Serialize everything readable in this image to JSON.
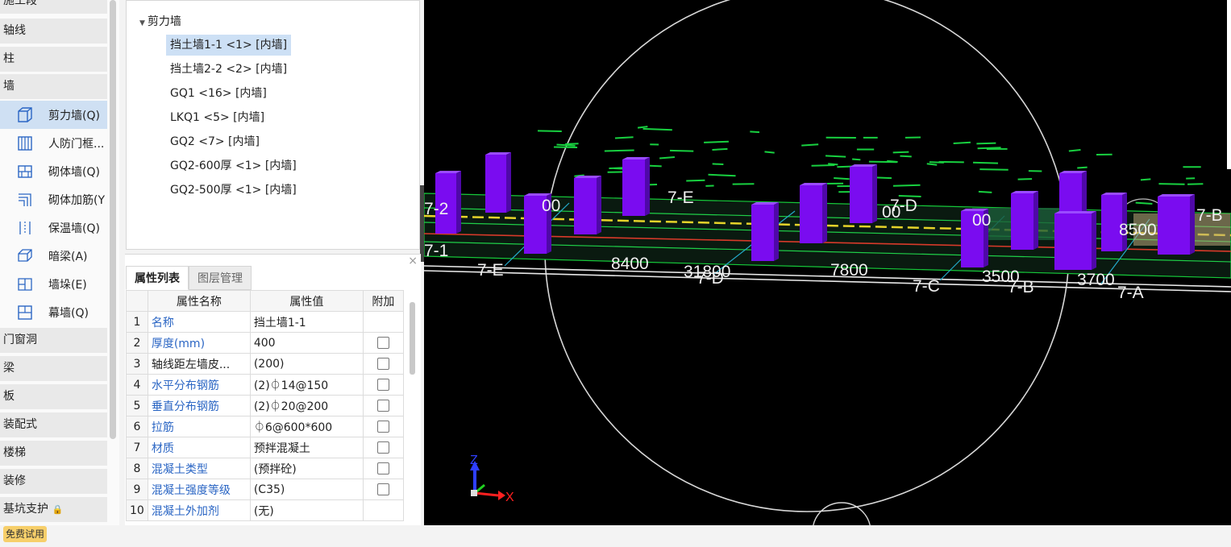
{
  "nav": {
    "top_partial": "施工段",
    "categories_top": [
      "轴线",
      "柱",
      "墙"
    ],
    "wall_items": [
      {
        "label": "剪力墙(Q)",
        "icon": "shear-wall-icon",
        "active": true
      },
      {
        "label": "人防门框...",
        "icon": "civil-defense-door-frame-icon"
      },
      {
        "label": "砌体墙(Q)",
        "icon": "masonry-wall-icon"
      },
      {
        "label": "砌体加筋(Y",
        "icon": "masonry-rebar-icon"
      },
      {
        "label": "保温墙(Q)",
        "icon": "insulation-wall-icon"
      },
      {
        "label": "暗梁(A)",
        "icon": "hidden-beam-icon"
      },
      {
        "label": "墙垛(E)",
        "icon": "wall-buttress-icon"
      },
      {
        "label": "幕墙(Q)",
        "icon": "curtain-wall-icon"
      }
    ],
    "categories_bottom": [
      "门窗洞",
      "梁",
      "板",
      "装配式",
      "楼梯",
      "装修"
    ],
    "last": {
      "label": "基坑支护",
      "badge": "免费试用"
    }
  },
  "tree": {
    "root": "剪力墙",
    "items": [
      "挡土墙1-1 <1> [内墙]",
      "挡土墙2-2 <2> [内墙]",
      "GQ1 <16> [内墙]",
      "LKQ1 <5> [内墙]",
      "GQ2 <7> [内墙]",
      "GQ2-600厚 <1> [内墙]",
      "GQ2-500厚 <1> [内墙]"
    ],
    "selected_index": 0
  },
  "props": {
    "close": "×",
    "tabs": [
      "属性列表",
      "图层管理"
    ],
    "headers": [
      "属性名称",
      "属性值",
      "附加"
    ],
    "rows": [
      {
        "no": "1",
        "name": "名称",
        "value": "挡土墙1-1",
        "blue": true,
        "check": false
      },
      {
        "no": "2",
        "name": "厚度(mm)",
        "value": "400",
        "blue": true,
        "check": true
      },
      {
        "no": "3",
        "name": "轴线距左墙皮...",
        "value": "(200)",
        "blue": false,
        "check": true
      },
      {
        "no": "4",
        "name": "水平分布钢筋",
        "value": "(2)⏀14@150",
        "blue": true,
        "check": true
      },
      {
        "no": "5",
        "name": "垂直分布钢筋",
        "value": "(2)⏀20@200",
        "blue": true,
        "check": true
      },
      {
        "no": "6",
        "name": "拉筋",
        "value": "⏀6@600*600",
        "blue": true,
        "check": true
      },
      {
        "no": "7",
        "name": "材质",
        "value": "预拌混凝土",
        "blue": true,
        "check": true
      },
      {
        "no": "8",
        "name": "混凝土类型",
        "value": "(预拌砼)",
        "blue": true,
        "check": true
      },
      {
        "no": "9",
        "name": "混凝土强度等级",
        "value": "(C35)",
        "blue": true,
        "check": true
      },
      {
        "no": "10",
        "name": "混凝土外加剂",
        "value": "(无)",
        "blue": true,
        "check": false
      }
    ]
  },
  "viewport": {
    "axis_labels": [
      "7-E",
      "7-D",
      "7-C",
      "7-B",
      "7-A",
      "7-2",
      "7-1",
      "7-E",
      "7-D",
      "7-B"
    ],
    "dimensions": [
      "8400",
      "31800",
      "7800",
      "3500",
      "3700",
      "8500",
      "00",
      "00",
      "00"
    ],
    "triad": {
      "z": "Z",
      "x": "X"
    },
    "colors": {
      "column": "#7a0cf0",
      "column_side": "#4f08a8",
      "slab_line": "#00cc33"
    }
  }
}
